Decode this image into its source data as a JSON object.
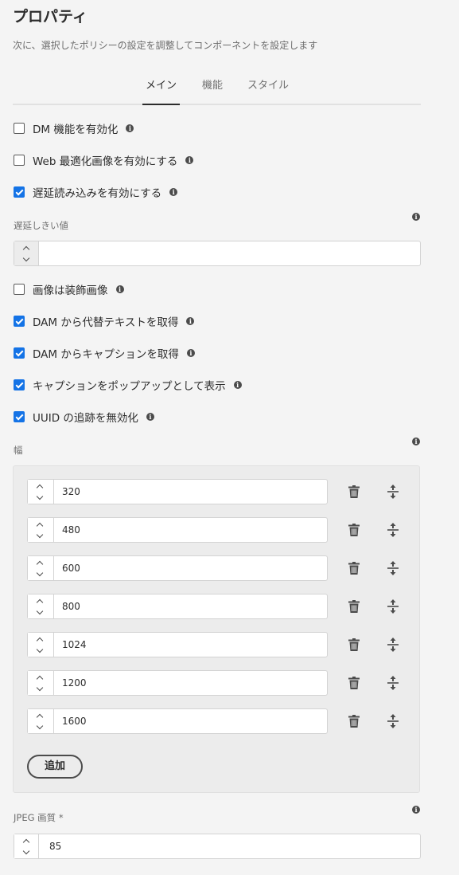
{
  "header": {
    "title": "プロパティ",
    "subtitle": "次に、選択したポリシーの設定を調整してコンポーネントを設定します"
  },
  "tabs": [
    {
      "label": "メイン",
      "active": true
    },
    {
      "label": "機能",
      "active": false
    },
    {
      "label": "スタイル",
      "active": false
    }
  ],
  "checkboxes_top": [
    {
      "label": "DM 機能を有効化",
      "checked": false
    },
    {
      "label": "Web 最適化画像を有効にする",
      "checked": false
    },
    {
      "label": "遅延読み込みを有効にする",
      "checked": true
    }
  ],
  "lazy_threshold": {
    "label": "遅延しきい値",
    "value": ""
  },
  "checkboxes_bottom": [
    {
      "label": "画像は装飾画像",
      "checked": false
    },
    {
      "label": "DAM から代替テキストを取得",
      "checked": true
    },
    {
      "label": "DAM からキャプションを取得",
      "checked": true
    },
    {
      "label": "キャプションをポップアップとして表示",
      "checked": true
    },
    {
      "label": "UUID の追跡を無効化",
      "checked": true
    }
  ],
  "widths": {
    "label": "幅",
    "values": [
      "320",
      "480",
      "600",
      "800",
      "1024",
      "1200",
      "1600"
    ],
    "add_label": "追加"
  },
  "jpeg_quality": {
    "label": "JPEG 画質 *",
    "value": "85"
  },
  "info_glyph": "i",
  "colors": {
    "accent": "#1473e6",
    "background": "#f4f4f4",
    "panel": "#ececec",
    "text": "#2c2c2c",
    "muted": "#6e6e6e"
  },
  "icons": [
    "info-icon",
    "trash-icon",
    "reorder-icon",
    "chevron-up-icon",
    "chevron-down-icon",
    "checkmark-icon"
  ]
}
